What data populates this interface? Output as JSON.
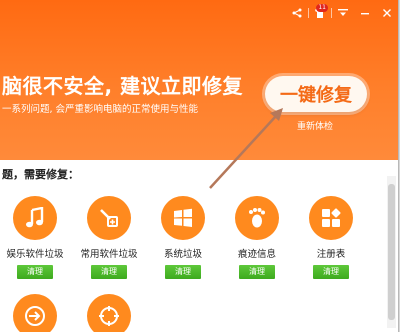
{
  "window": {
    "headline": "脑很不安全, 建议立即修复",
    "subline": "一系列问题, 会严重影响电脑的正常使用与性能",
    "fix_button": "一键修复",
    "recheck": "重新体检",
    "section_title": "题，需要修复：",
    "notification_count": "11"
  },
  "items": [
    {
      "label": "娱乐软件垃圾",
      "icon": "music-note-icon",
      "action": "清理"
    },
    {
      "label": "常用软件垃圾",
      "icon": "brush-icon",
      "action": "清理"
    },
    {
      "label": "系统垃圾",
      "icon": "windows-icon",
      "action": "清理"
    },
    {
      "label": "痕迹信息",
      "icon": "footprint-icon",
      "action": "清理"
    },
    {
      "label": "注册表",
      "icon": "registry-blocks-icon",
      "action": "清理"
    }
  ],
  "colors": {
    "banner": "#ff7a22",
    "accent": "#ff8a1e",
    "clean_button": "#4cb82a",
    "arrow": "#b5785a"
  }
}
